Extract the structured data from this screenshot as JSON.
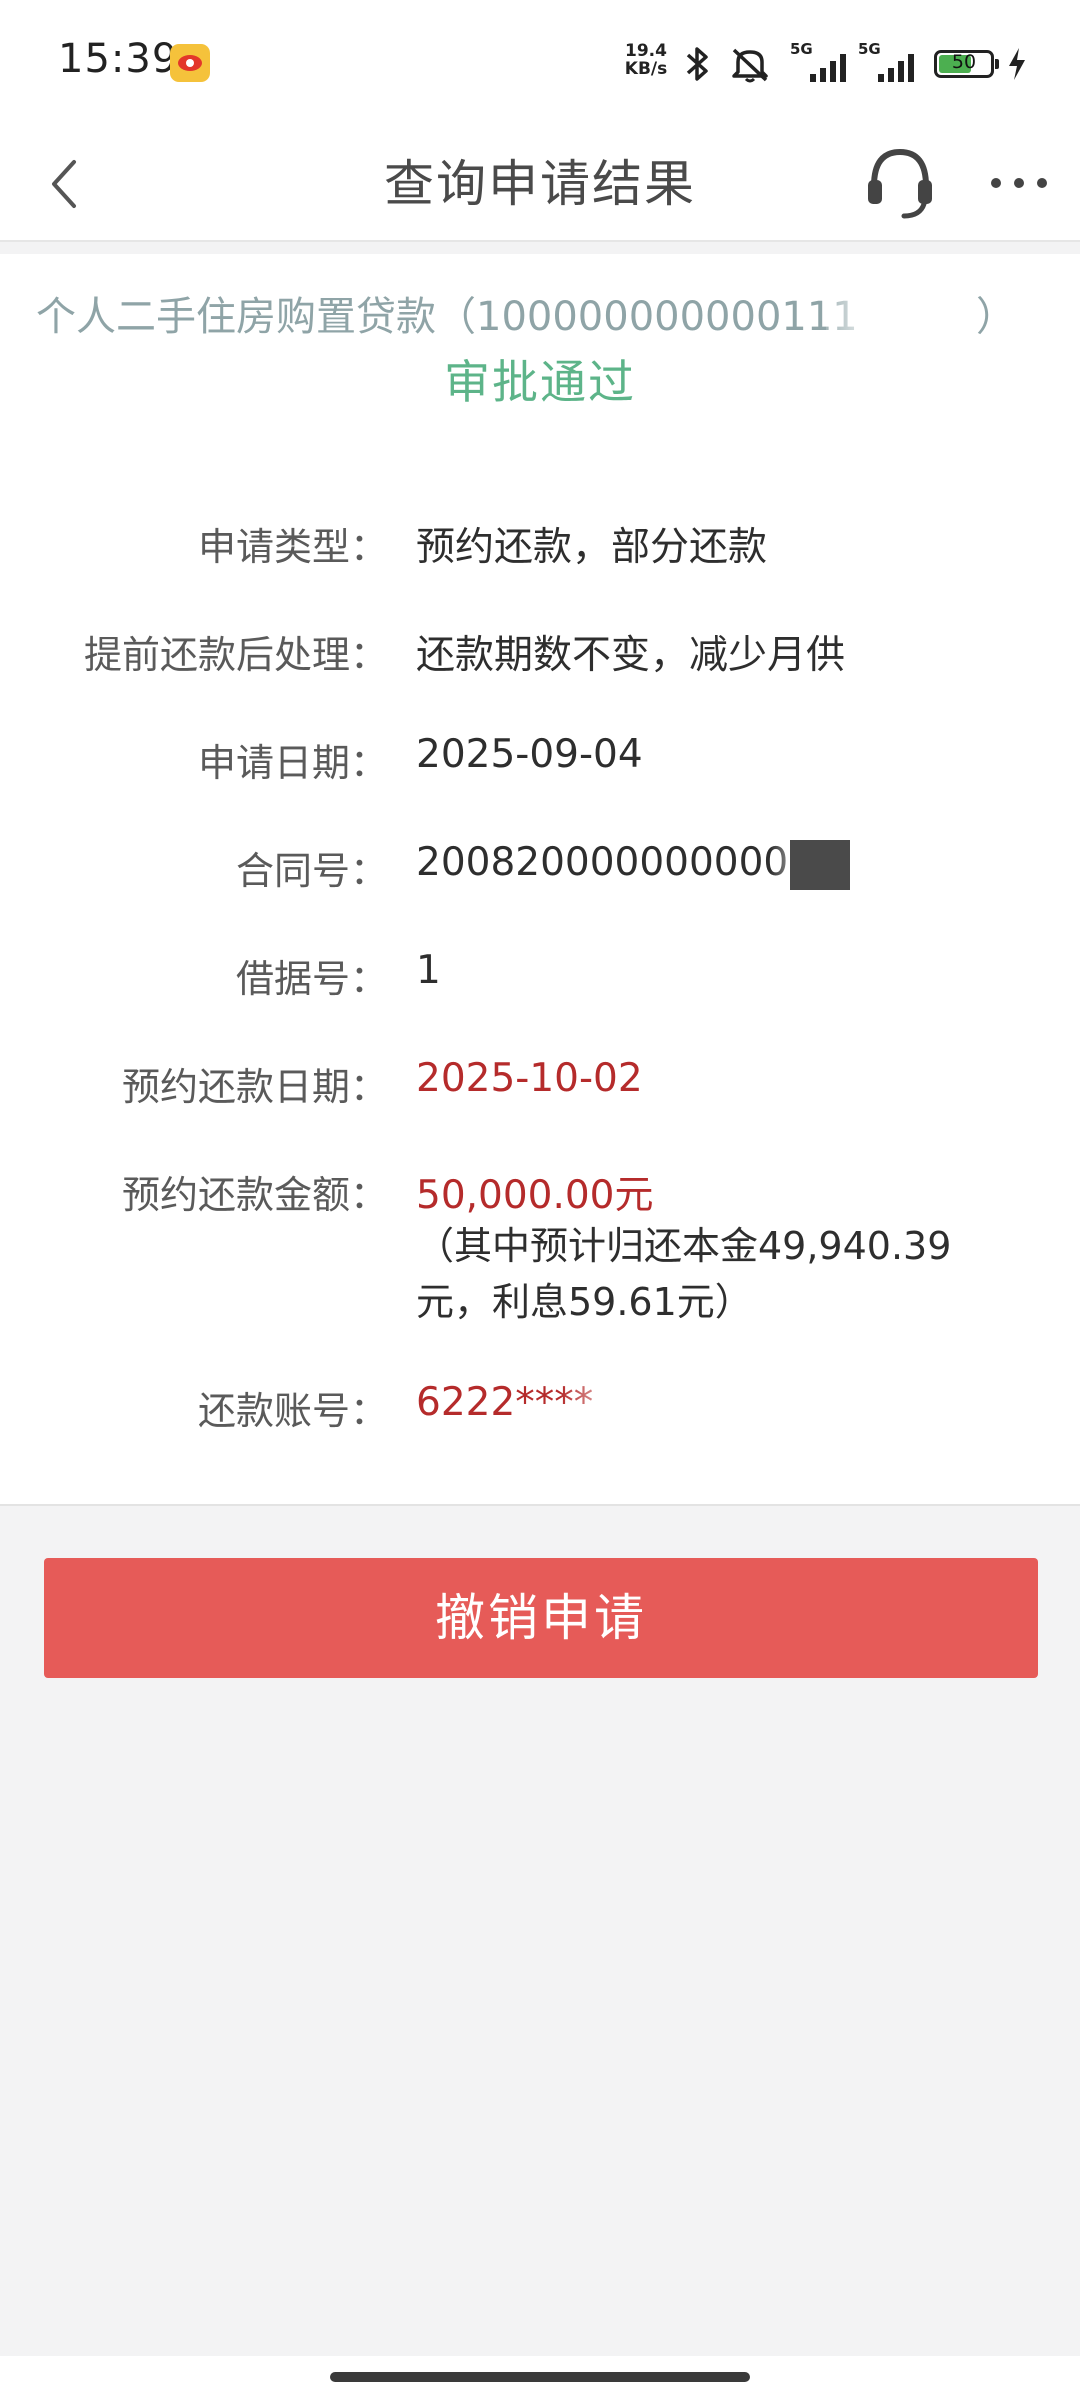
{
  "status_bar": {
    "time": "15:39",
    "net_speed_value": "19.4",
    "net_speed_unit": "KB/s",
    "signal_1_label": "5G",
    "signal_2_label": "5G",
    "battery_level": "50",
    "icons": [
      "weibo-icon",
      "bluetooth-icon",
      "mute-icon",
      "signal-icon",
      "battery-icon",
      "charging-icon"
    ]
  },
  "nav": {
    "title": "查询申请结果",
    "back_icon": "chevron-left-icon",
    "service_icon": "headset-icon",
    "more_icon": "more-dots-icon"
  },
  "result": {
    "loan_title": "个人二手住房购置贷款（100000000000111",
    "loan_title_end": "）",
    "status": "审批通过"
  },
  "details": [
    {
      "label": "申请类型：",
      "value": "预约还款，部分还款"
    },
    {
      "label": "提前还款后处理：",
      "value": "还款期数不变，减少月供"
    },
    {
      "label": "申请日期：",
      "value": "2025-09-04"
    },
    {
      "label": "合同号：",
      "value": "200820000000000"
    },
    {
      "label": "借据号：",
      "value": "1"
    },
    {
      "label": "预约还款日期：",
      "value": "2025-10-02"
    },
    {
      "label": "预约还款金额：",
      "value": "50,000.00元",
      "note": "（其中预计归还本金49,940.39元，利息59.61元）"
    },
    {
      "label": "还款账号：",
      "value": "6222****"
    }
  ],
  "actions": {
    "cancel_label": "撤销申请"
  },
  "colors": {
    "accent_red": "#b52b2b",
    "button_red": "#e65b58",
    "approved_green": "#5db489",
    "background": "#f3f3f4"
  }
}
